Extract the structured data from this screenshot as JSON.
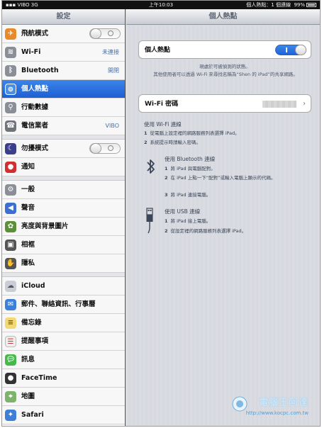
{
  "status_bar": {
    "carrier": "VIBO",
    "network": "3G",
    "time": "上午10:03",
    "hotspot_status": "個人熱點：1 個連線",
    "battery": "99%"
  },
  "sidebar": {
    "title": "設定",
    "items": [
      {
        "label": "飛航模式",
        "icon": "airplane-icon",
        "toggle": "off"
      },
      {
        "label": "Wi-Fi",
        "icon": "wifi-icon",
        "value": "未連接"
      },
      {
        "label": "Bluetooth",
        "icon": "bluetooth-icon",
        "value": "開閉"
      },
      {
        "label": "個人熱點",
        "icon": "hotspot-icon",
        "selected": true
      },
      {
        "label": "行動數據",
        "icon": "cellular-icon"
      },
      {
        "label": "電信業者",
        "icon": "carrier-icon",
        "value": "VIBO"
      },
      {
        "label": "勿擾模式",
        "icon": "moon-icon",
        "toggle": "off"
      },
      {
        "label": "通知",
        "icon": "notifications-icon"
      },
      {
        "label": "一般",
        "icon": "gear-icon"
      },
      {
        "label": "聲音",
        "icon": "speaker-icon"
      },
      {
        "label": "亮度與背景圖片",
        "icon": "flower-icon"
      },
      {
        "label": "相框",
        "icon": "picture-frame-icon"
      },
      {
        "label": "隱私",
        "icon": "hand-icon"
      },
      {
        "label": "iCloud",
        "icon": "cloud-icon"
      },
      {
        "label": "郵件、聯絡資訊、行事曆",
        "icon": "mail-icon"
      },
      {
        "label": "備忘錄",
        "icon": "notes-icon"
      },
      {
        "label": "提醒事項",
        "icon": "reminders-icon"
      },
      {
        "label": "訊息",
        "icon": "messages-icon"
      },
      {
        "label": "FaceTime",
        "icon": "facetime-icon"
      },
      {
        "label": "地圖",
        "icon": "maps-icon"
      },
      {
        "label": "Safari",
        "icon": "safari-icon"
      }
    ]
  },
  "main": {
    "title": "個人熱點",
    "hotspot_label": "個人熱點",
    "hotspot_toggle": "on",
    "note1": "現處於可被偵測的狀態。",
    "note2": "其他使用者可以透過 Wi-Fi 來尋找名稱為“Shen 的 iPad”的共享網路。",
    "wifi_password_label": "Wi-Fi 密碼",
    "wifi_section": {
      "title": "使用 Wi-Fi 連線",
      "steps": [
        "從電腦上設定裡的網路服務列表選擇 iPad。",
        "系統提示時請輸入密碼。"
      ]
    },
    "bt_section": {
      "title": "使用 Bluetooth 連線",
      "steps": [
        "將 iPad 與電腦配對。",
        "在 iPad 上點一下“配對”或輸入電腦上顯示的代碼。",
        "將 iPad 連接電腦。"
      ]
    },
    "usb_section": {
      "title": "使用 USB 連線",
      "steps": [
        "將 iPad 接上電腦。",
        "從設定裡的網路服務列表選擇 iPad。"
      ]
    },
    "step_numbers": [
      "1",
      "2",
      "3"
    ]
  },
  "watermark": {
    "title": "電腦王阿達",
    "url": "http://www.kocpc.com.tw"
  },
  "colors": {
    "selected_row": "#1e5fd3",
    "toggle_on": "#1f63d6",
    "value_text": "#4a6fa5"
  }
}
